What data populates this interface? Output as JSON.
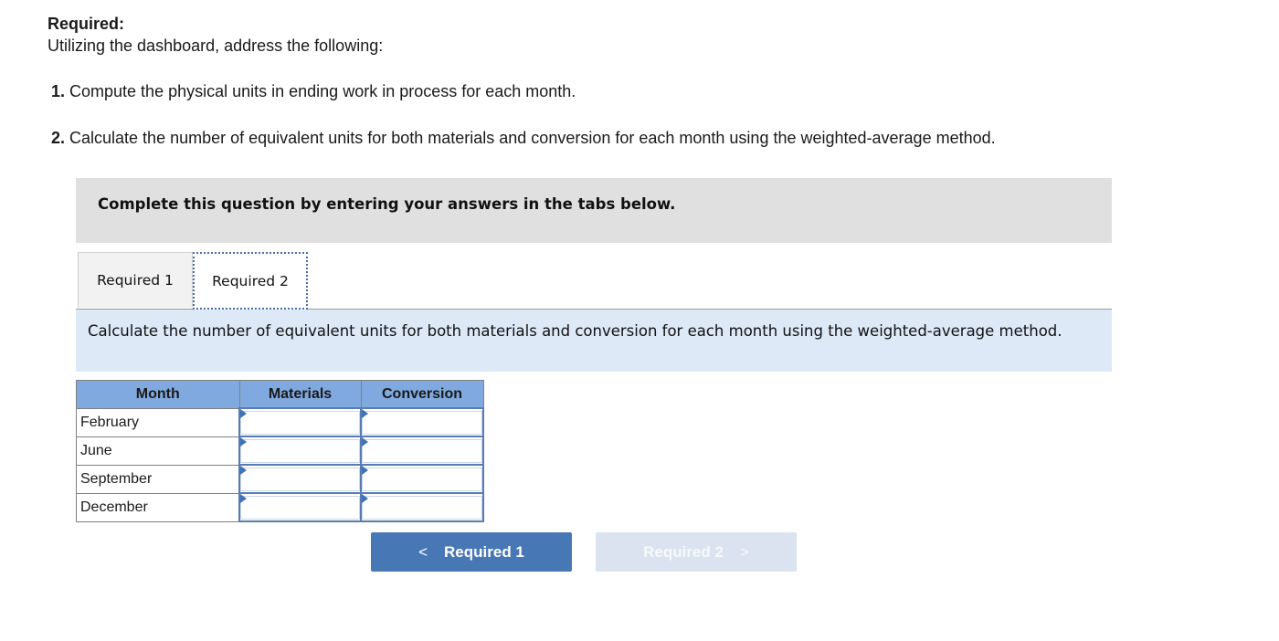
{
  "header": {
    "required_label": "Required:",
    "intro": "Utilizing the dashboard, address the following:"
  },
  "questions": [
    {
      "number": "1.",
      "text": " Compute the physical units in ending work in process for each month."
    },
    {
      "number": "2.",
      "text": " Calculate the number of equivalent units for both materials and conversion for each month using the weighted-average method."
    }
  ],
  "banner": {
    "text": "Complete this question by entering your answers in the tabs below."
  },
  "tabs": [
    {
      "label": "Required 1",
      "active": false
    },
    {
      "label": "Required 2",
      "active": true
    }
  ],
  "instruction": "Calculate the number of equivalent units for both materials and conversion for each month using the weighted-average method.",
  "table": {
    "headers": [
      "Month",
      "Materials",
      "Conversion"
    ],
    "rows": [
      {
        "month": "February",
        "materials": "",
        "conversion": ""
      },
      {
        "month": "June",
        "materials": "",
        "conversion": ""
      },
      {
        "month": "September",
        "materials": "",
        "conversion": ""
      },
      {
        "month": "December",
        "materials": "",
        "conversion": ""
      }
    ]
  },
  "nav": {
    "prev_label": "Required 1",
    "prev_icon": "chevron-left-icon",
    "next_label": "Required 2",
    "next_icon": "chevron-right-icon",
    "next_disabled": true
  },
  "colors": {
    "header_blue": "#7fa9df",
    "button_blue": "#4777b5",
    "button_disabled": "#dae3ef",
    "instruction_bg": "#dde9f7",
    "banner_bg": "#e0e0e0"
  }
}
